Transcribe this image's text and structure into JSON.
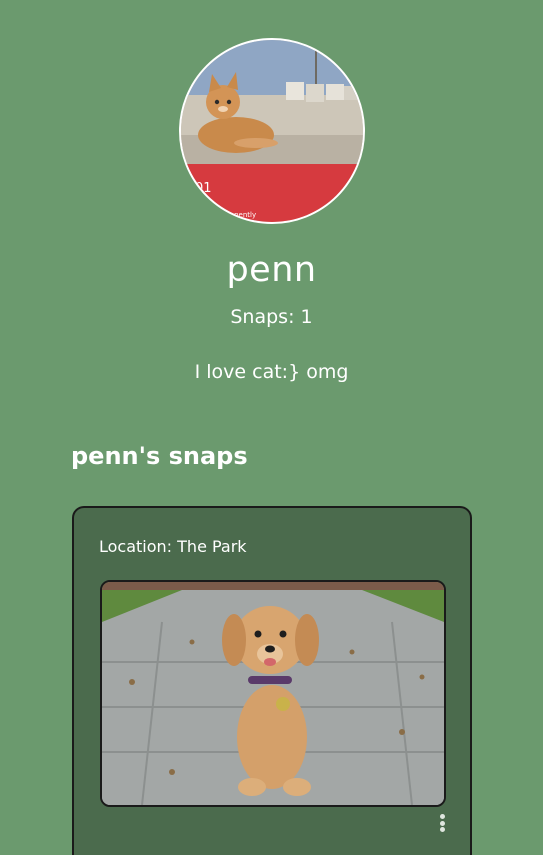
{
  "profile": {
    "username": "penn",
    "snap_count": "Snaps: 1",
    "bio": "I love cat:} omg",
    "avatar_icon": "cat-photo",
    "avatar_overlay_text": "01",
    "avatar_overlay_small": "manently"
  },
  "snaps_section": {
    "title": "penn's snaps"
  },
  "snaps": [
    {
      "location": "Location: The Park",
      "image_icon": "puppy-photo",
      "menu_icon": "more-vertical-icon"
    }
  ],
  "colors": {
    "background": "#6b9a6e",
    "card": "#4b6b4d",
    "text": "#ffffff",
    "avatar_banner": "#d63a3f"
  }
}
